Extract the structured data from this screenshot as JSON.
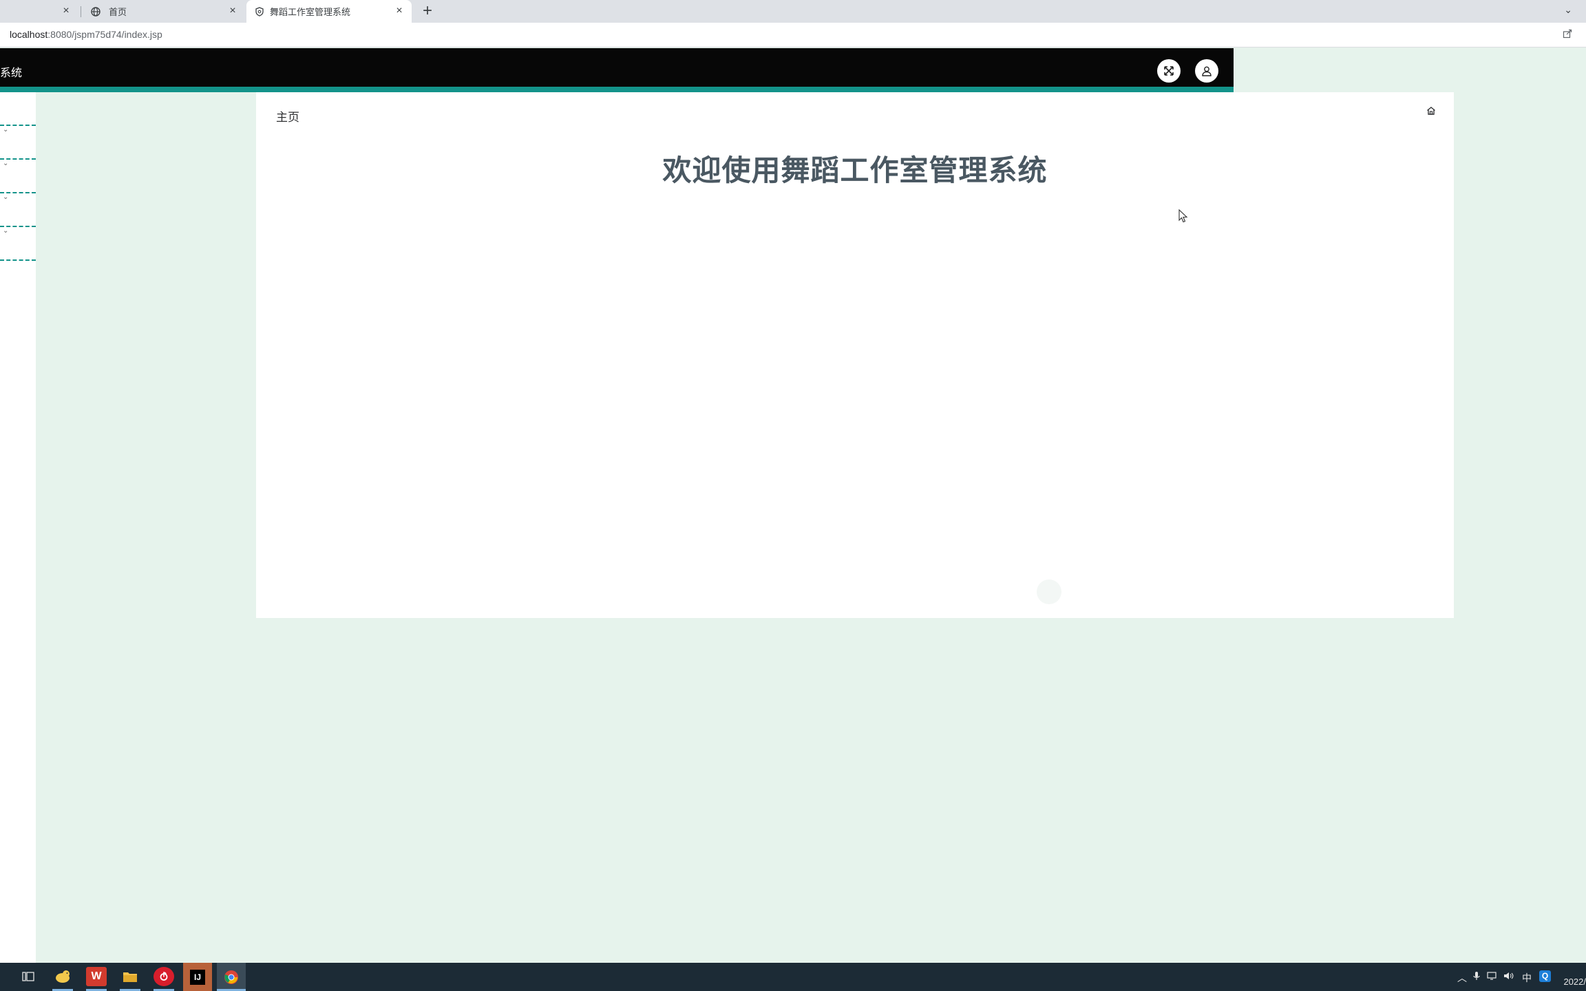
{
  "browser": {
    "tabs": [
      {
        "label": ""
      },
      {
        "label": "首页"
      },
      {
        "label": "舞蹈工作室管理系统"
      }
    ],
    "url_host": "localhost",
    "url_rest": ":8080/jspm75d74/index.jsp"
  },
  "header": {
    "title": "系统"
  },
  "sidebar": {
    "items": [
      {
        "label": ""
      },
      {
        "label": ""
      },
      {
        "label": ""
      },
      {
        "label": ""
      },
      {
        "label": ""
      }
    ]
  },
  "main": {
    "breadcrumb": "主页",
    "welcome": "欢迎使用舞蹈工作室管理系统"
  },
  "taskbar": {
    "ime": "中",
    "clock": "2022/"
  },
  "colors": {
    "header_bg": "#070707",
    "accent": "#13938a",
    "page_bg": "#e6f3ec",
    "welcome_text": "#4a5862"
  }
}
